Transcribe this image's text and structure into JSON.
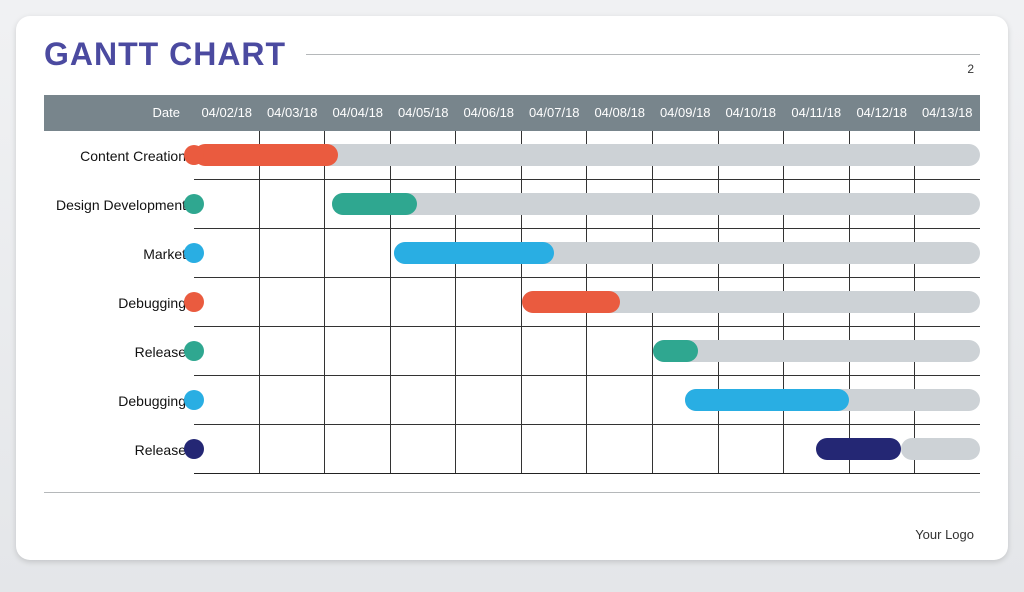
{
  "title": "GANTT CHART",
  "page_number": "2",
  "logo_text": "Your Logo",
  "header_label": "Date",
  "dates": [
    "04/02/18",
    "04/03/18",
    "04/04/18",
    "04/05/18",
    "04/06/18",
    "04/07/18",
    "04/08/18",
    "04/09/18",
    "04/10/18",
    "04/11/18",
    "04/12/18",
    "04/13/18"
  ],
  "tasks": [
    {
      "name": "Content Creation",
      "color": "#ea5b3f",
      "dot": "#ea5b3f",
      "barStart": 0,
      "barEnd": 2.2,
      "underStart": 0.05,
      "underEnd": 12
    },
    {
      "name": "Design Development",
      "color": "#2fa790",
      "dot": "#2fa790",
      "barStart": 2.1,
      "barEnd": 3.4,
      "underStart": 2.1,
      "underEnd": 12
    },
    {
      "name": "Market",
      "color": "#29aee3",
      "dot": "#29aee3",
      "barStart": 3.05,
      "barEnd": 5.5,
      "underStart": 3.05,
      "underEnd": 12
    },
    {
      "name": "Debugging",
      "color": "#ea5b3f",
      "dot": "#ea5b3f",
      "barStart": 5.0,
      "barEnd": 6.5,
      "underStart": 5.0,
      "underEnd": 12
    },
    {
      "name": "Release",
      "color": "#2fa790",
      "dot": "#2fa790",
      "barStart": 7.0,
      "barEnd": 7.7,
      "underStart": 7.0,
      "underEnd": 12
    },
    {
      "name": "Debugging",
      "color": "#29aee3",
      "dot": "#29aee3",
      "barStart": 7.5,
      "barEnd": 10.0,
      "underStart": 7.5,
      "underEnd": 12
    },
    {
      "name": "Release",
      "color": "#242774",
      "dot": "#242774",
      "barStart": 9.5,
      "barEnd": 10.8,
      "underStart": 10.8,
      "underEnd": 12
    }
  ],
  "chart_data": {
    "type": "bar",
    "orientation": "horizontal-gantt",
    "title": "GANTT CHART",
    "xlabel": "Date",
    "x_categories": [
      "04/02/18",
      "04/03/18",
      "04/04/18",
      "04/05/18",
      "04/06/18",
      "04/07/18",
      "04/08/18",
      "04/09/18",
      "04/10/18",
      "04/11/18",
      "04/12/18",
      "04/13/18"
    ],
    "series": [
      {
        "name": "Content Creation",
        "start": "04/02/18",
        "end": "04/04/18",
        "remaining_to": "04/13/18",
        "color": "#ea5b3f"
      },
      {
        "name": "Design Development",
        "start": "04/04/18",
        "end": "04/05/18",
        "remaining_to": "04/13/18",
        "color": "#2fa790"
      },
      {
        "name": "Market",
        "start": "04/05/18",
        "end": "04/07/18",
        "remaining_to": "04/13/18",
        "color": "#29aee3"
      },
      {
        "name": "Debugging",
        "start": "04/07/18",
        "end": "04/08/18",
        "remaining_to": "04/13/18",
        "color": "#ea5b3f"
      },
      {
        "name": "Release",
        "start": "04/09/18",
        "end": "04/09/18",
        "remaining_to": "04/13/18",
        "color": "#2fa790"
      },
      {
        "name": "Debugging",
        "start": "04/09/18",
        "end": "04/12/18",
        "remaining_to": "04/13/18",
        "color": "#29aee3"
      },
      {
        "name": "Release",
        "start": "04/11/18",
        "end": "04/12/18",
        "remaining_to": "04/13/18",
        "color": "#242774"
      }
    ],
    "xlim": [
      "04/02/18",
      "04/13/18"
    ]
  }
}
